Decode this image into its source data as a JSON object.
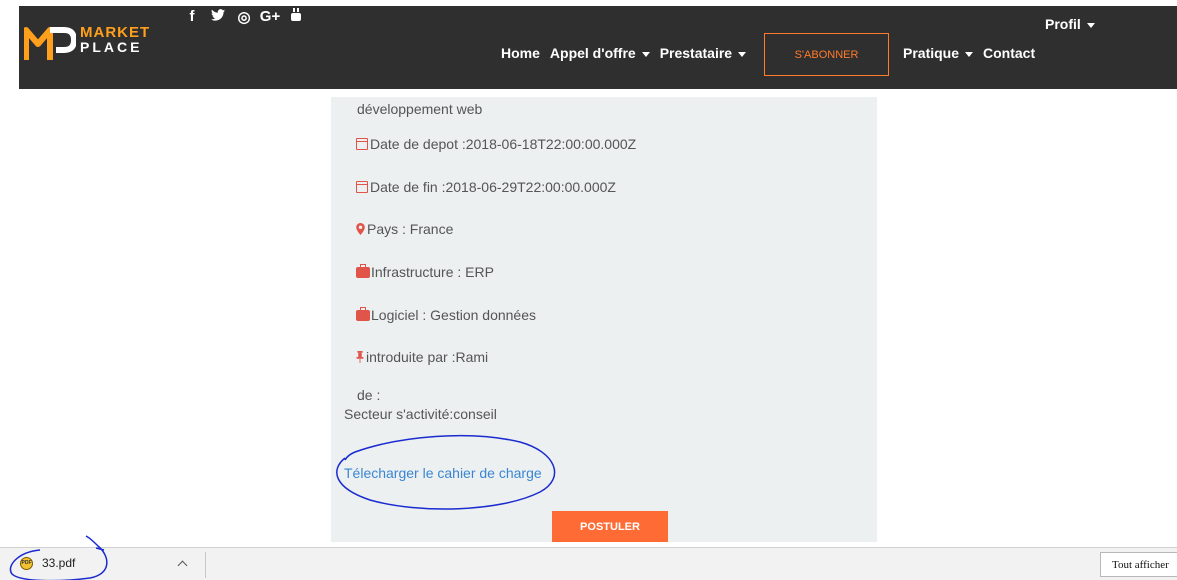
{
  "navbar": {
    "logo_line1": "MARKET",
    "logo_line2": "PLACE",
    "social": [
      "f",
      "🐦",
      "◎",
      "G+",
      "▶"
    ],
    "links": [
      {
        "label": "Home",
        "dropdown": false
      },
      {
        "label": "Appel d'offre",
        "dropdown": true
      },
      {
        "label": "Prestataire",
        "dropdown": true
      }
    ],
    "subscribe_label": "S'ABONNER",
    "links_right": [
      {
        "label": "Pratique",
        "dropdown": true
      },
      {
        "label": "Contact",
        "dropdown": false
      }
    ],
    "profile_label": "Profil"
  },
  "detail": {
    "category": "développement web",
    "date_depot": "Date de depot :2018-06-18T22:00:00.000Z",
    "date_fin": "Date de fin :2018-06-29T22:00:00.000Z",
    "pays": "Pays : France",
    "infrastructure": "Infrastructure : ERP",
    "logiciel": "Logiciel : Gestion données",
    "introduite": "introduite par :Rami",
    "de": "de :",
    "secteur": "Secteur s'activité:conseil",
    "download_link": "Télecharger le cahier de charge",
    "apply_button": "POSTULER"
  },
  "download_bar": {
    "file_name": "33.pdf",
    "pdf_icon_text": "PDF",
    "show_all": "Tout afficher"
  },
  "colors": {
    "navbar_bg": "#2f2f2f",
    "accent_orange": "#ff6b35",
    "logo_orange": "#ff9f1c",
    "icon_red": "#e0544a",
    "link_blue": "#3a86d4",
    "card_bg": "#ecf0f0",
    "annotation_blue": "#1a2bd0"
  }
}
